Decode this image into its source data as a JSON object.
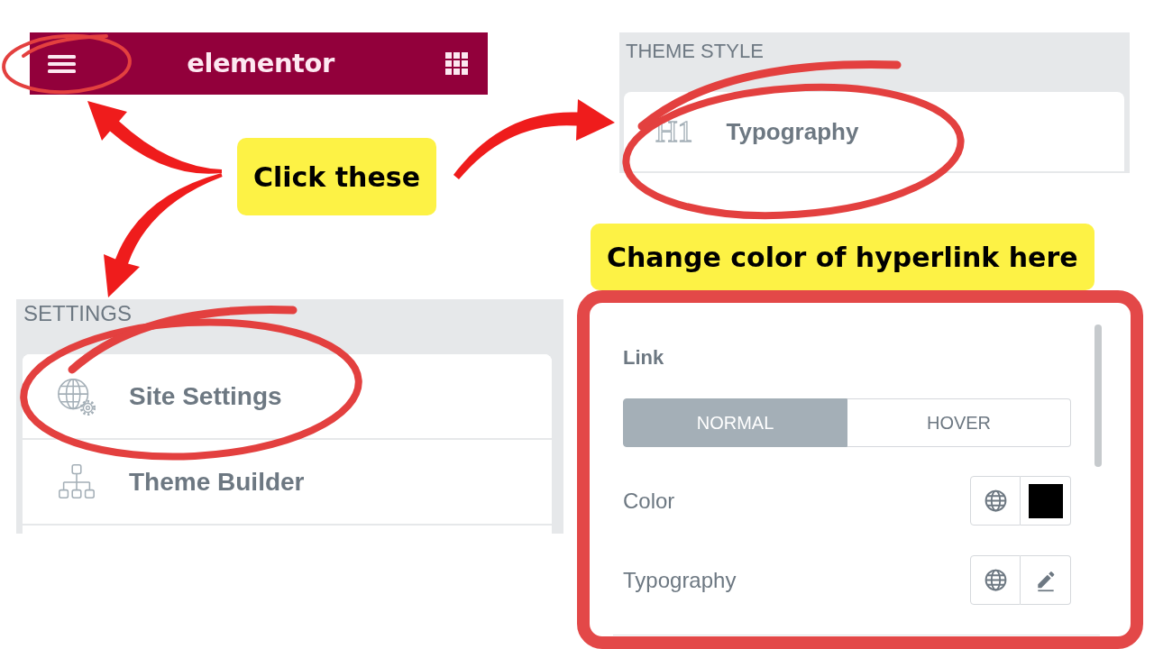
{
  "header": {
    "logo": "elementor"
  },
  "theme_style": {
    "heading": "THEME STYLE",
    "items": [
      {
        "icon_text": "H1",
        "label": "Typography"
      }
    ]
  },
  "callouts": [
    {
      "text": "Click these"
    },
    {
      "text": "Change color of hyperlink here"
    }
  ],
  "settings": {
    "heading": "SETTINGS",
    "items": [
      {
        "label": "Site Settings"
      },
      {
        "label": "Theme Builder"
      }
    ]
  },
  "link_panel": {
    "title": "Link",
    "tabs": [
      {
        "label": "NORMAL",
        "selected": true
      },
      {
        "label": "HOVER",
        "selected": false
      }
    ],
    "rows": [
      {
        "kind": "color",
        "label": "Color",
        "color": "#000000"
      },
      {
        "kind": "typography",
        "label": "Typography"
      }
    ]
  }
}
